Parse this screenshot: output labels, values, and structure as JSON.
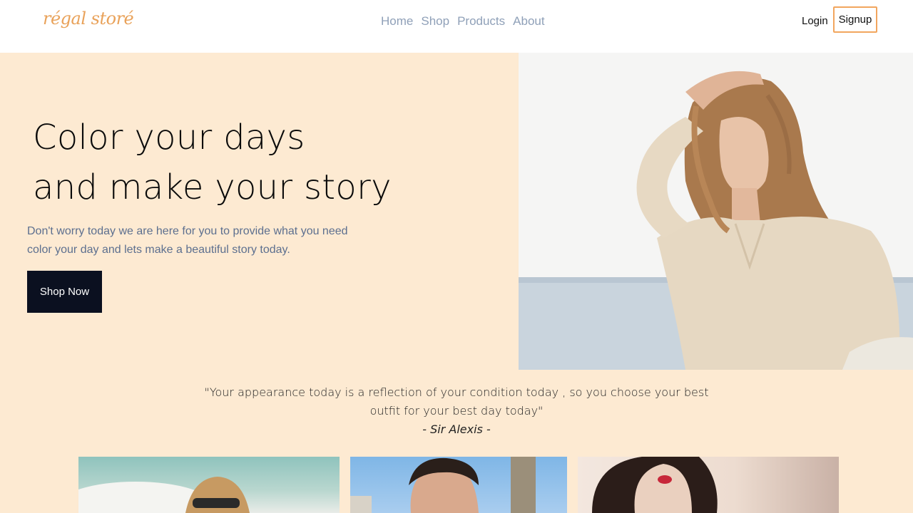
{
  "brand": {
    "logo_text": "régal storé"
  },
  "nav": {
    "links": [
      "Home",
      "Shop",
      "Products",
      "About"
    ],
    "login_label": "Login",
    "signup_label": "Signup"
  },
  "hero": {
    "title_line1": "Color your days",
    "title_line2": "and make your story",
    "description": "Don't worry today we are here for you to provide what you need color your day and lets make a beautiful story today.",
    "cta_label": "Shop Now"
  },
  "quote": {
    "text": "\"Your appearance today is a reflection of your condition today , so you choose your best outfit for your best day today\"",
    "author": "- Sir Alexis -"
  },
  "colors": {
    "background": "#fdead2",
    "accent": "#f2a65e",
    "nav_link": "#8fa0b8",
    "cta": "#0b1020"
  }
}
